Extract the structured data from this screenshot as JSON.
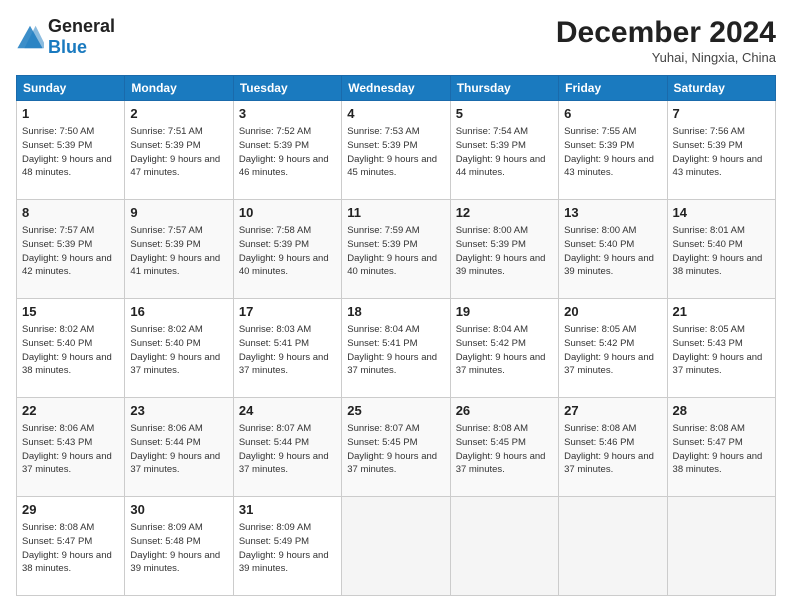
{
  "header": {
    "logo_line1": "General",
    "logo_line2": "Blue",
    "month_title": "December 2024",
    "location": "Yuhai, Ningxia, China"
  },
  "days_of_week": [
    "Sunday",
    "Monday",
    "Tuesday",
    "Wednesday",
    "Thursday",
    "Friday",
    "Saturday"
  ],
  "weeks": [
    [
      {
        "num": "1",
        "sunrise": "7:50 AM",
        "sunset": "5:39 PM",
        "daylight": "9 hours and 48 minutes."
      },
      {
        "num": "2",
        "sunrise": "7:51 AM",
        "sunset": "5:39 PM",
        "daylight": "9 hours and 47 minutes."
      },
      {
        "num": "3",
        "sunrise": "7:52 AM",
        "sunset": "5:39 PM",
        "daylight": "9 hours and 46 minutes."
      },
      {
        "num": "4",
        "sunrise": "7:53 AM",
        "sunset": "5:39 PM",
        "daylight": "9 hours and 45 minutes."
      },
      {
        "num": "5",
        "sunrise": "7:54 AM",
        "sunset": "5:39 PM",
        "daylight": "9 hours and 44 minutes."
      },
      {
        "num": "6",
        "sunrise": "7:55 AM",
        "sunset": "5:39 PM",
        "daylight": "9 hours and 43 minutes."
      },
      {
        "num": "7",
        "sunrise": "7:56 AM",
        "sunset": "5:39 PM",
        "daylight": "9 hours and 43 minutes."
      }
    ],
    [
      {
        "num": "8",
        "sunrise": "7:57 AM",
        "sunset": "5:39 PM",
        "daylight": "9 hours and 42 minutes."
      },
      {
        "num": "9",
        "sunrise": "7:57 AM",
        "sunset": "5:39 PM",
        "daylight": "9 hours and 41 minutes."
      },
      {
        "num": "10",
        "sunrise": "7:58 AM",
        "sunset": "5:39 PM",
        "daylight": "9 hours and 40 minutes."
      },
      {
        "num": "11",
        "sunrise": "7:59 AM",
        "sunset": "5:39 PM",
        "daylight": "9 hours and 40 minutes."
      },
      {
        "num": "12",
        "sunrise": "8:00 AM",
        "sunset": "5:39 PM",
        "daylight": "9 hours and 39 minutes."
      },
      {
        "num": "13",
        "sunrise": "8:00 AM",
        "sunset": "5:40 PM",
        "daylight": "9 hours and 39 minutes."
      },
      {
        "num": "14",
        "sunrise": "8:01 AM",
        "sunset": "5:40 PM",
        "daylight": "9 hours and 38 minutes."
      }
    ],
    [
      {
        "num": "15",
        "sunrise": "8:02 AM",
        "sunset": "5:40 PM",
        "daylight": "9 hours and 38 minutes."
      },
      {
        "num": "16",
        "sunrise": "8:02 AM",
        "sunset": "5:40 PM",
        "daylight": "9 hours and 37 minutes."
      },
      {
        "num": "17",
        "sunrise": "8:03 AM",
        "sunset": "5:41 PM",
        "daylight": "9 hours and 37 minutes."
      },
      {
        "num": "18",
        "sunrise": "8:04 AM",
        "sunset": "5:41 PM",
        "daylight": "9 hours and 37 minutes."
      },
      {
        "num": "19",
        "sunrise": "8:04 AM",
        "sunset": "5:42 PM",
        "daylight": "9 hours and 37 minutes."
      },
      {
        "num": "20",
        "sunrise": "8:05 AM",
        "sunset": "5:42 PM",
        "daylight": "9 hours and 37 minutes."
      },
      {
        "num": "21",
        "sunrise": "8:05 AM",
        "sunset": "5:43 PM",
        "daylight": "9 hours and 37 minutes."
      }
    ],
    [
      {
        "num": "22",
        "sunrise": "8:06 AM",
        "sunset": "5:43 PM",
        "daylight": "9 hours and 37 minutes."
      },
      {
        "num": "23",
        "sunrise": "8:06 AM",
        "sunset": "5:44 PM",
        "daylight": "9 hours and 37 minutes."
      },
      {
        "num": "24",
        "sunrise": "8:07 AM",
        "sunset": "5:44 PM",
        "daylight": "9 hours and 37 minutes."
      },
      {
        "num": "25",
        "sunrise": "8:07 AM",
        "sunset": "5:45 PM",
        "daylight": "9 hours and 37 minutes."
      },
      {
        "num": "26",
        "sunrise": "8:08 AM",
        "sunset": "5:45 PM",
        "daylight": "9 hours and 37 minutes."
      },
      {
        "num": "27",
        "sunrise": "8:08 AM",
        "sunset": "5:46 PM",
        "daylight": "9 hours and 37 minutes."
      },
      {
        "num": "28",
        "sunrise": "8:08 AM",
        "sunset": "5:47 PM",
        "daylight": "9 hours and 38 minutes."
      }
    ],
    [
      {
        "num": "29",
        "sunrise": "8:08 AM",
        "sunset": "5:47 PM",
        "daylight": "9 hours and 38 minutes."
      },
      {
        "num": "30",
        "sunrise": "8:09 AM",
        "sunset": "5:48 PM",
        "daylight": "9 hours and 39 minutes."
      },
      {
        "num": "31",
        "sunrise": "8:09 AM",
        "sunset": "5:49 PM",
        "daylight": "9 hours and 39 minutes."
      },
      null,
      null,
      null,
      null
    ]
  ],
  "labels": {
    "sunrise": "Sunrise: ",
    "sunset": "Sunset: ",
    "daylight": "Daylight: "
  }
}
